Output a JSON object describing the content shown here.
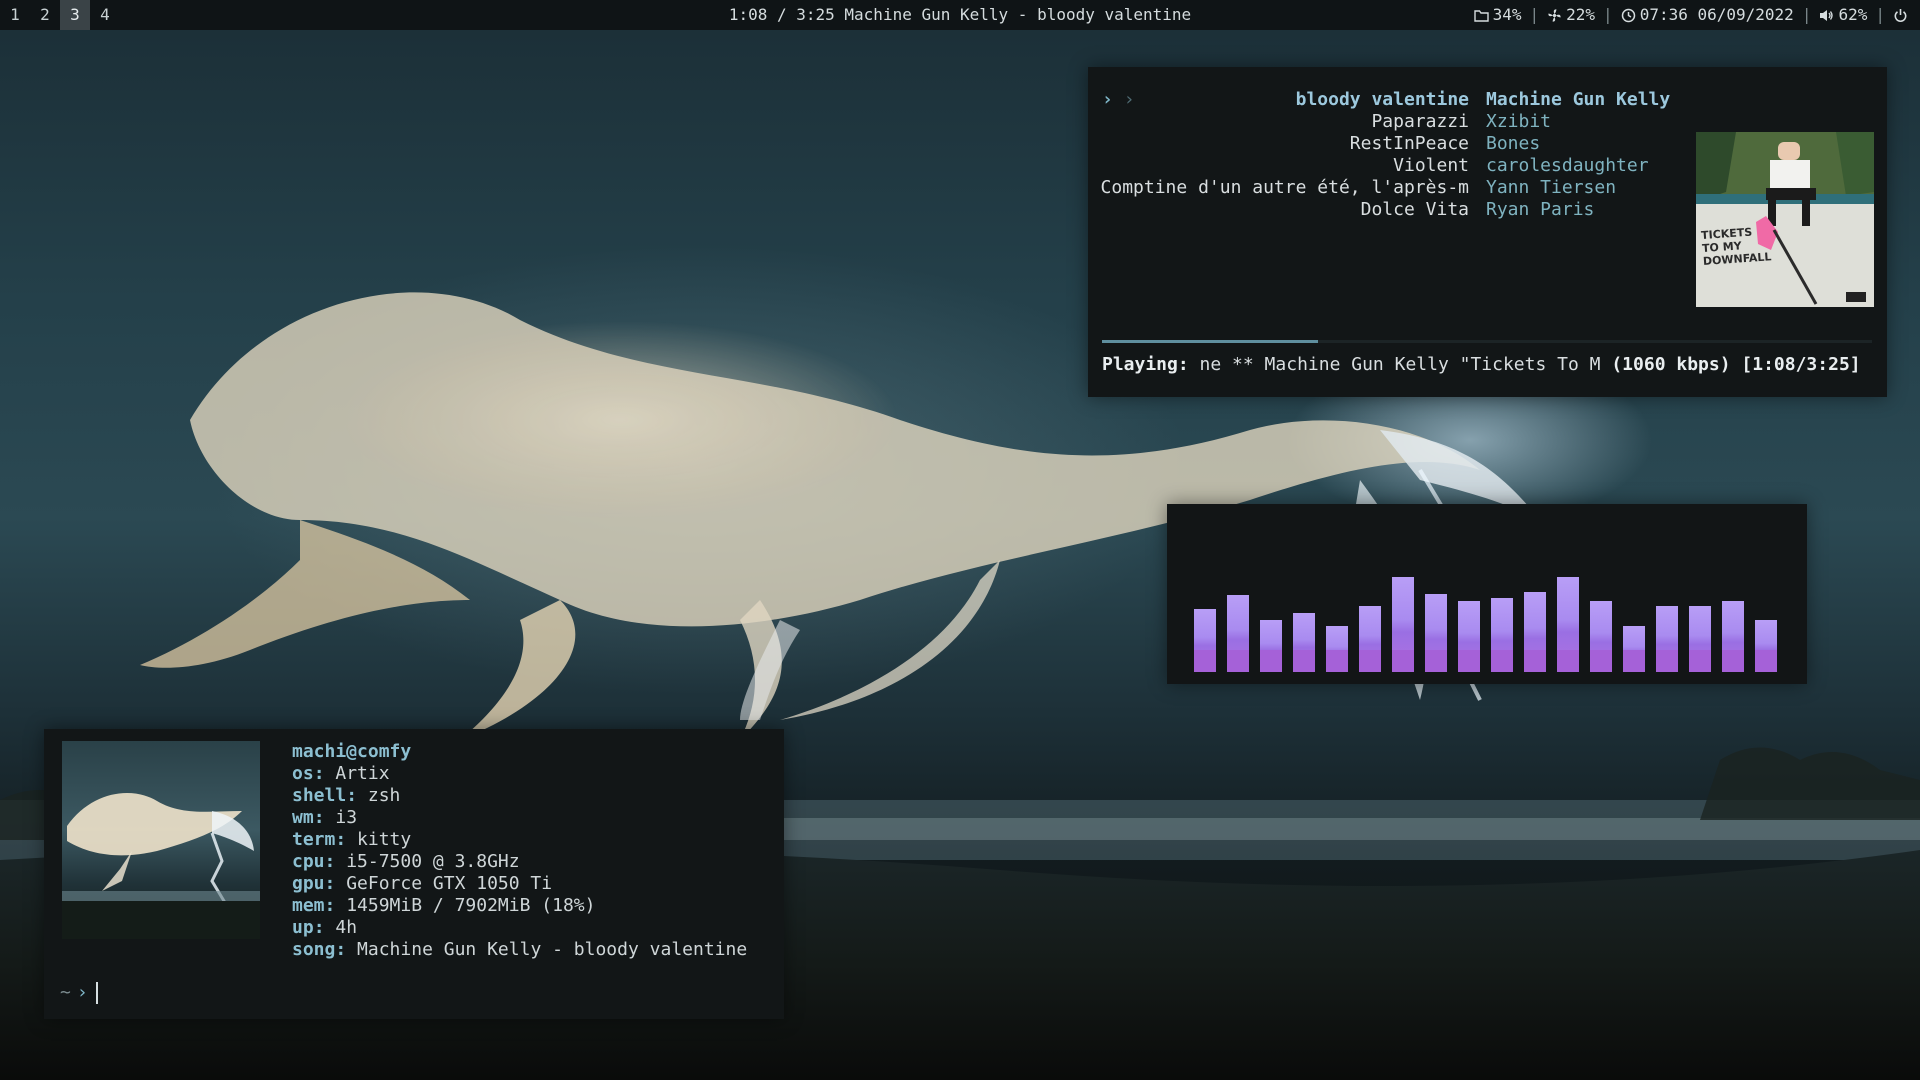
{
  "workspaces": [
    {
      "label": "1",
      "active": false
    },
    {
      "label": "2",
      "active": false
    },
    {
      "label": "3",
      "active": true
    },
    {
      "label": "4",
      "active": false
    }
  ],
  "topbar": {
    "now_playing": "1:08 / 3:25 Machine Gun Kelly - bloody valentine",
    "status": {
      "disk": "34%",
      "cpu": "22%",
      "clock": "07:36 06/09/2022",
      "volume": "62%"
    },
    "icons": {
      "disk": "folder-icon",
      "cpu": "fan-icon",
      "clock": "clock-icon",
      "volume": "speaker-icon",
      "power": "power-icon"
    }
  },
  "player": {
    "prompt": "›",
    "prompt_dim": "›",
    "tracks": [
      {
        "title": "bloody valentine",
        "artist": "Machine Gun Kelly",
        "current": true
      },
      {
        "title": "Paparazzi",
        "artist": "Xzibit",
        "current": false
      },
      {
        "title": "RestInPeace",
        "artist": "Bones",
        "current": false
      },
      {
        "title": "Violent",
        "artist": "carolesdaughter",
        "current": false
      },
      {
        "title": "Comptine d'un autre été, l'après-m",
        "artist": "Yann Tiersen",
        "current": false
      },
      {
        "title": "Dolce Vita",
        "artist": "Ryan Paris",
        "current": false
      }
    ],
    "cover_text": "TICKETS TO MY DOWNFALL",
    "progress_fraction": 0.28,
    "status_label": "Playing:",
    "status_text": " ne ** Machine Gun Kelly \"Tickets To M ",
    "bitrate": "(1060 kbps)",
    "time": "[1:08/3:25]"
  },
  "visualizer": {
    "levels": [
      0.45,
      0.55,
      0.37,
      0.42,
      0.33,
      0.47,
      0.68,
      0.56,
      0.51,
      0.53,
      0.57,
      0.68,
      0.51,
      0.33,
      0.47,
      0.47,
      0.51,
      0.37
    ]
  },
  "terminal": {
    "user": "machi@comfy",
    "fetch": [
      {
        "key": "os",
        "value": "Artix"
      },
      {
        "key": "shell",
        "value": "zsh"
      },
      {
        "key": "wm",
        "value": "i3"
      },
      {
        "key": "term",
        "value": "kitty"
      },
      {
        "key": "cpu",
        "value": "i5-7500 @ 3.8GHz"
      },
      {
        "key": "gpu",
        "value": "GeForce GTX 1050 Ti"
      },
      {
        "key": "mem",
        "value": "1459MiB / 7902MiB (18%)"
      },
      {
        "key": "up",
        "value": "4h"
      },
      {
        "key": "song",
        "value": "Machine Gun Kelly - bloody valentine"
      }
    ],
    "prompt_dir": "~",
    "prompt_arrow": "›"
  }
}
